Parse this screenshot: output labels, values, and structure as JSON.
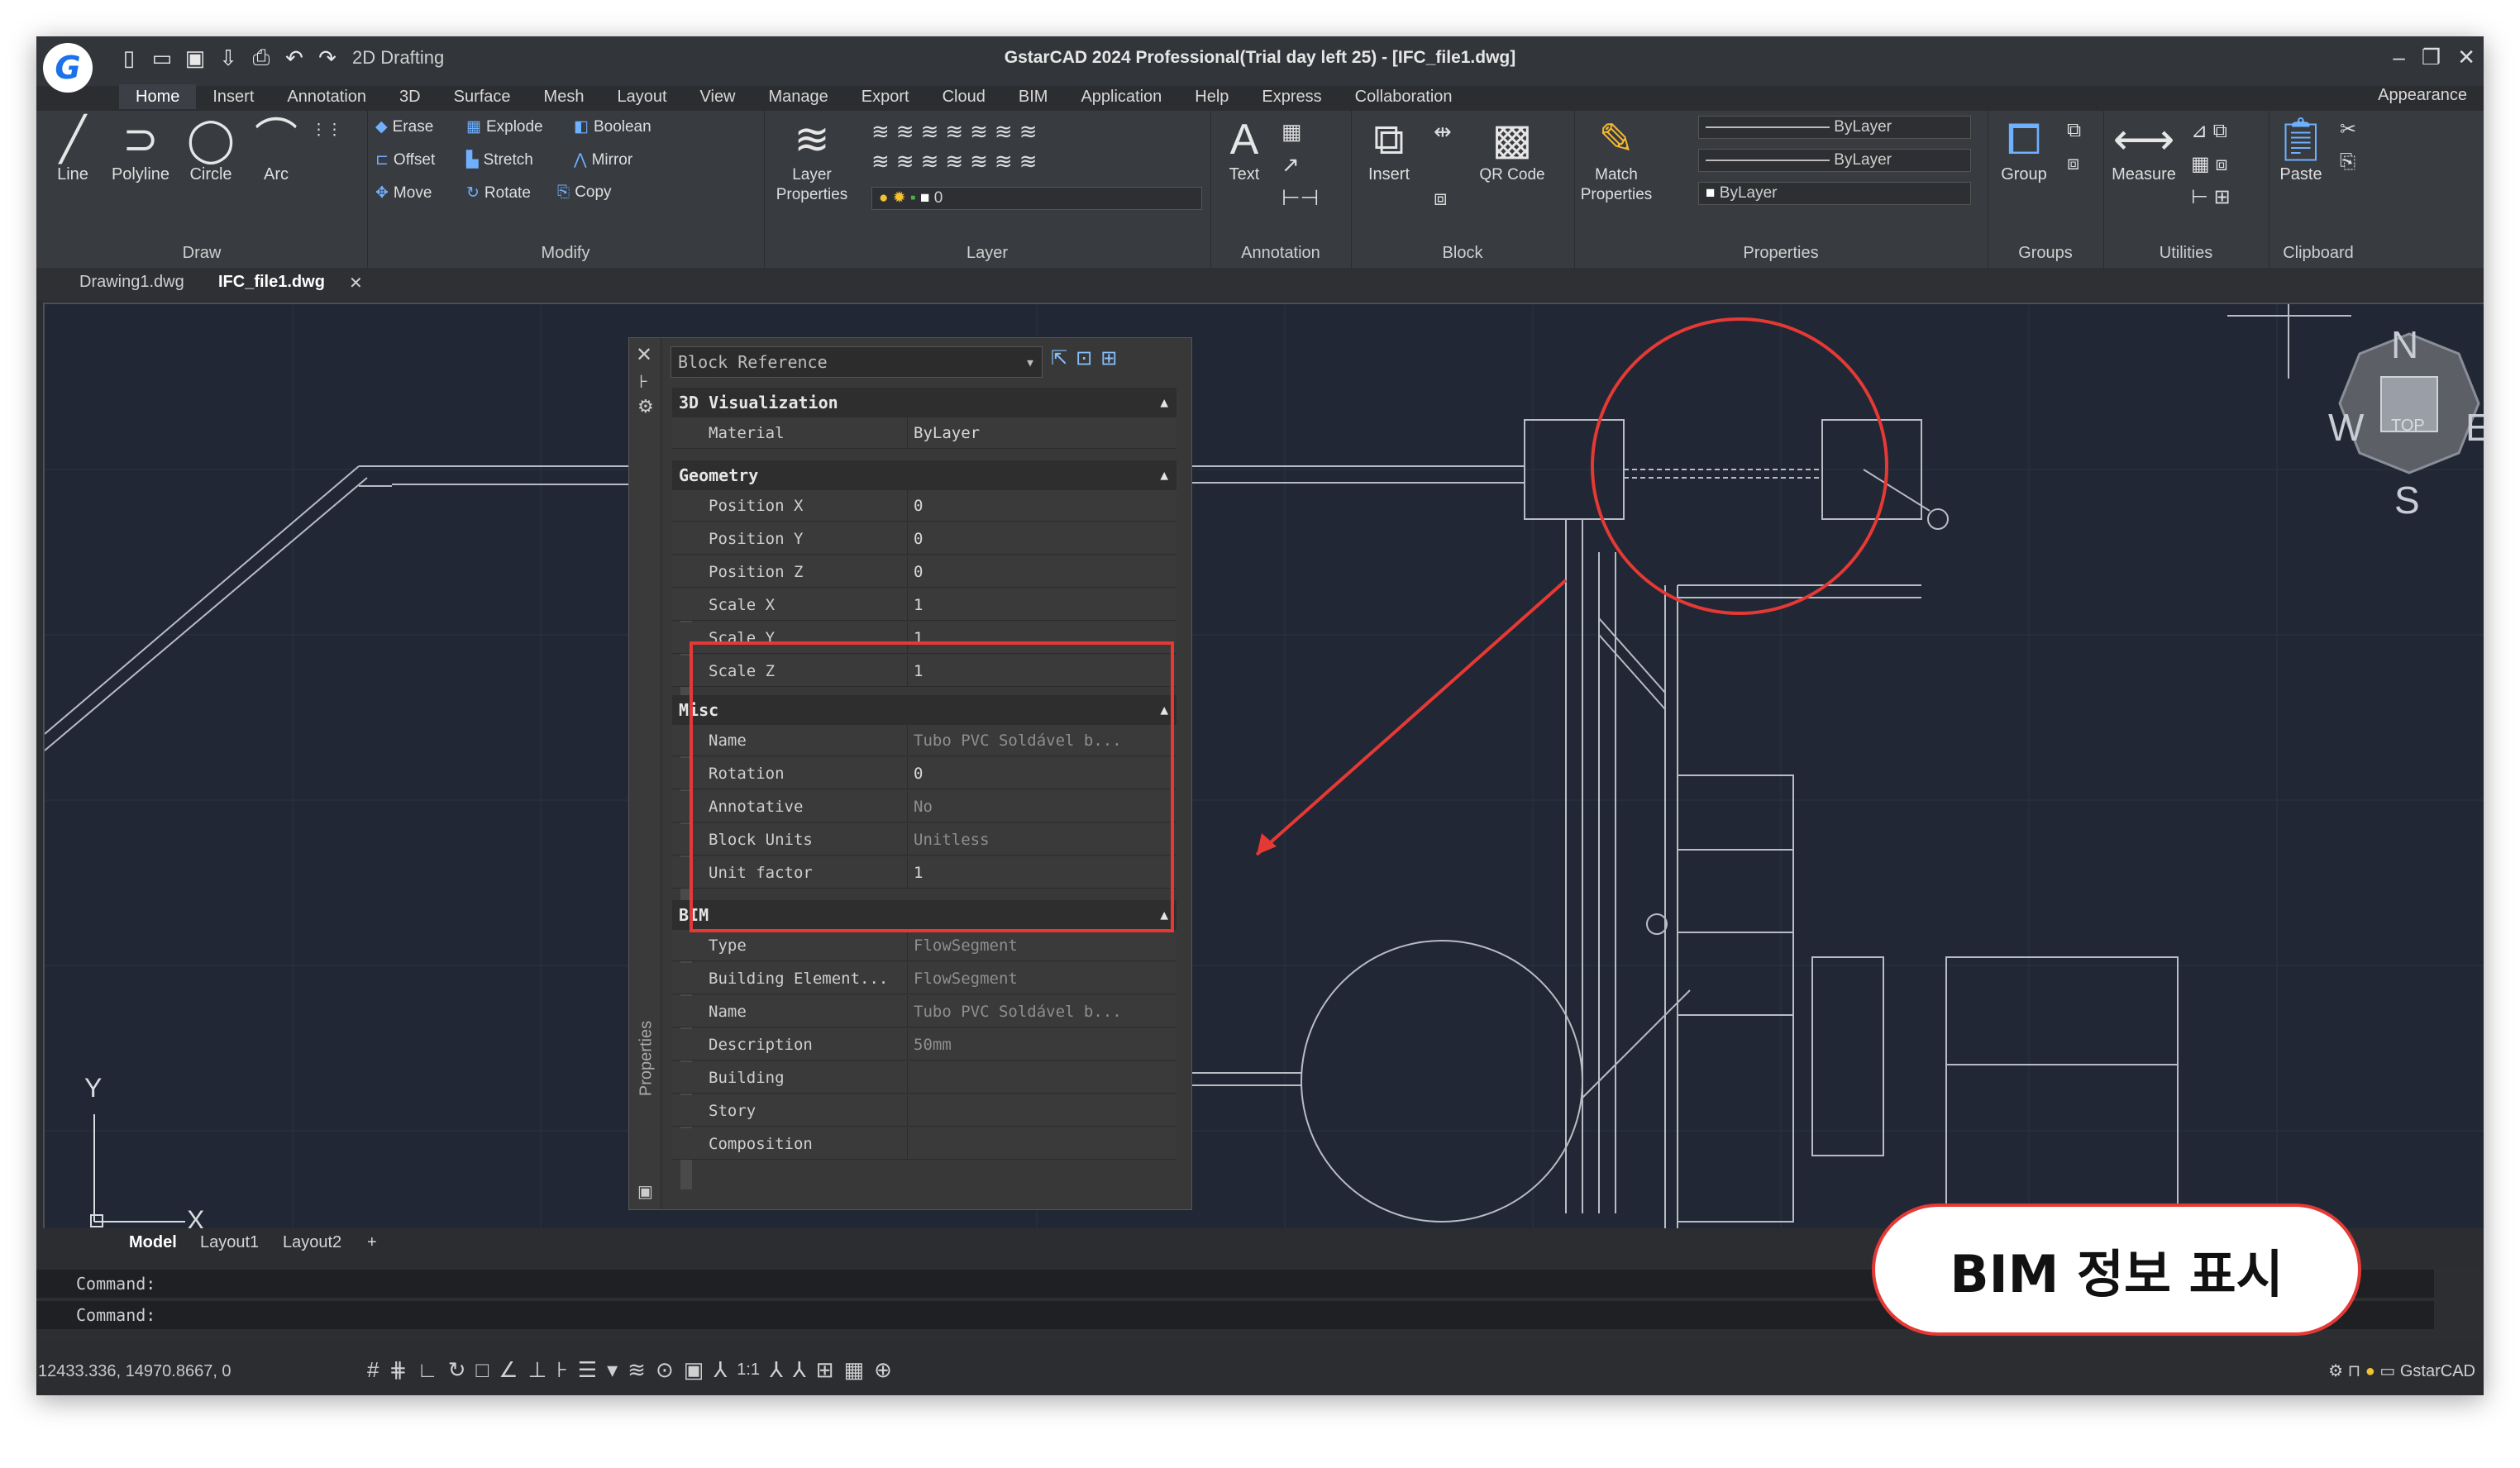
{
  "app": {
    "title": "GstarCAD 2024 Professional(Trial day left 25) - [IFC_file1.dwg]",
    "workspace": "2D Drafting",
    "logo_letter": "G"
  },
  "menu": [
    "Home",
    "Insert",
    "Annotation",
    "3D",
    "Surface",
    "Mesh",
    "Layout",
    "View",
    "Manage",
    "Export",
    "Cloud",
    "BIM",
    "Application",
    "Help",
    "Express",
    "Collaboration"
  ],
  "appearance_label": "Appearance",
  "ribbon": {
    "draw": {
      "line": "Line",
      "polyline": "Polyline",
      "circle": "Circle",
      "arc": "Arc",
      "label": "Draw"
    },
    "modify": {
      "erase": "Erase",
      "explode": "Explode",
      "boolean": "Boolean",
      "offset": "Offset",
      "stretch": "Stretch",
      "mirror": "Mirror",
      "move": "Move",
      "rotate": "Rotate",
      "copy": "Copy",
      "label": "Modify"
    },
    "layer": {
      "props": "Layer Properties",
      "current": "0",
      "label": "Layer"
    },
    "annotation": {
      "text": "Text",
      "label": "Annotation"
    },
    "block": {
      "insert": "Insert",
      "qr": "QR Code",
      "label": "Block"
    },
    "properties": {
      "match": "Match Properties",
      "bylayer1": "ByLayer",
      "bylayer2": "ByLayer",
      "bylayer3": "ByLayer",
      "label": "Properties"
    },
    "groups": {
      "group": "Group",
      "label": "Groups"
    },
    "utilities": {
      "measure": "Measure",
      "label": "Utilities"
    },
    "clipboard": {
      "paste": "Paste",
      "label": "Clipboard"
    }
  },
  "doc_tabs": [
    "Drawing1.dwg",
    "IFC_file1.dwg"
  ],
  "properties_panel": {
    "selector": "Block Reference",
    "side_label": "Properties",
    "sections": {
      "vis": "3D Visualization",
      "geometry": "Geometry",
      "misc": "Misc",
      "bim": "BIM"
    },
    "vis_rows": [
      {
        "k": "Material",
        "v": "ByLayer"
      }
    ],
    "geometry_rows": [
      {
        "k": "Position X",
        "v": "0"
      },
      {
        "k": "Position Y",
        "v": "0"
      },
      {
        "k": "Position Z",
        "v": "0"
      },
      {
        "k": "Scale X",
        "v": "1"
      },
      {
        "k": "Scale Y",
        "v": "1"
      },
      {
        "k": "Scale Z",
        "v": "1"
      }
    ],
    "misc_rows": [
      {
        "k": "Name",
        "v": "Tubo PVC Soldável b..."
      },
      {
        "k": "Rotation",
        "v": "0"
      },
      {
        "k": "Annotative",
        "v": "No"
      },
      {
        "k": "Block Units",
        "v": "Unitless"
      },
      {
        "k": "Unit factor",
        "v": "1"
      }
    ],
    "bim_rows": [
      {
        "k": "Type",
        "v": "FlowSegment"
      },
      {
        "k": "Building Element...",
        "v": "FlowSegment"
      },
      {
        "k": "Name",
        "v": "Tubo PVC Soldável b..."
      },
      {
        "k": "Description",
        "v": "50mm"
      },
      {
        "k": "Building",
        "v": ""
      },
      {
        "k": "Story",
        "v": ""
      },
      {
        "k": "Composition",
        "v": ""
      }
    ]
  },
  "viewcube": {
    "n": "N",
    "s": "S",
    "e": "E",
    "w": "W",
    "top": "TOP"
  },
  "ucs": {
    "x": "X",
    "y": "Y"
  },
  "layout_tabs": [
    "Model",
    "Layout1",
    "Layout2",
    "+"
  ],
  "command": {
    "line1": "Command:",
    "line2": "Command:"
  },
  "status": {
    "coords": "12433.336, 14970.8667, 0",
    "scale": "1:1",
    "product": "GstarCAD"
  },
  "callout": "BIM 정보 표시",
  "colors": {
    "accent_red": "#e53935",
    "canvas_bg": "#212734"
  }
}
